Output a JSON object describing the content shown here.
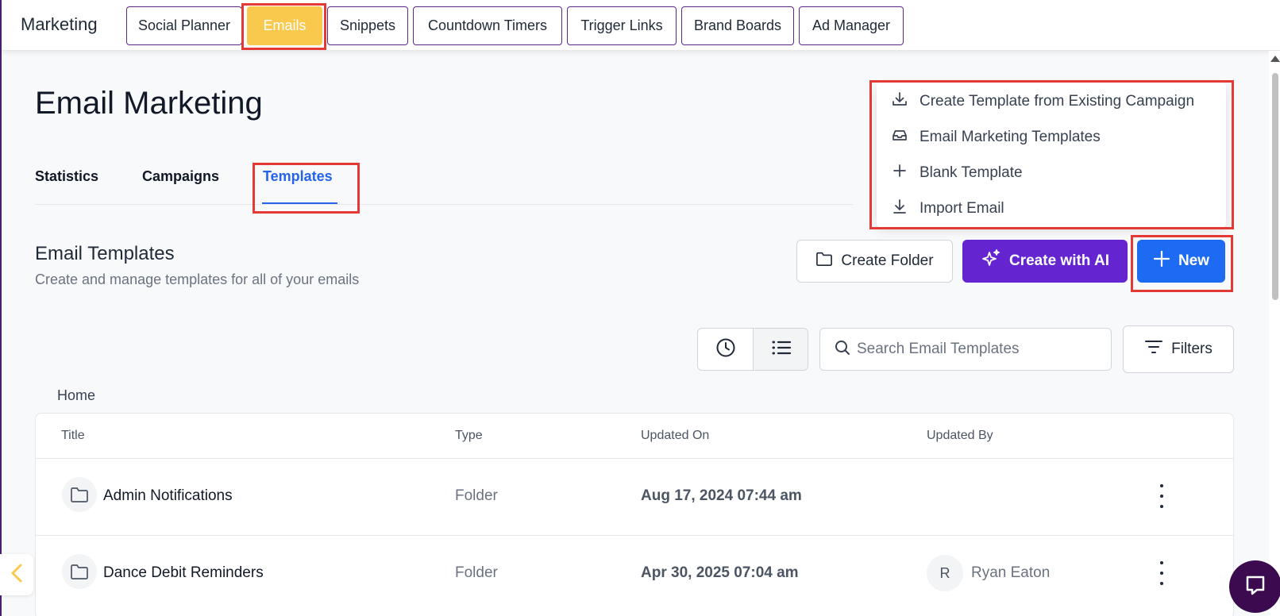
{
  "topbar": {
    "brand": "Marketing",
    "tabs": [
      {
        "label": "Social Planner"
      },
      {
        "label": "Emails"
      },
      {
        "label": "Snippets"
      },
      {
        "label": "Countdown Timers"
      },
      {
        "label": "Trigger Links"
      },
      {
        "label": "Brand Boards"
      },
      {
        "label": "Ad Manager"
      }
    ]
  },
  "page": {
    "title": "Email Marketing",
    "tabs": [
      {
        "label": "Statistics"
      },
      {
        "label": "Campaigns"
      },
      {
        "label": "Templates"
      }
    ]
  },
  "section": {
    "title": "Email Templates",
    "subtitle": "Create and manage templates for all of your emails"
  },
  "actions": {
    "create_folder": "Create Folder",
    "create_ai": "Create with AI",
    "new": "New"
  },
  "menu": {
    "items": [
      {
        "label": "Create Template from Existing Campaign",
        "icon": "download-tray-icon"
      },
      {
        "label": "Email Marketing Templates",
        "icon": "inbox-icon"
      },
      {
        "label": "Blank Template",
        "icon": "plus-icon"
      },
      {
        "label": "Import Email",
        "icon": "import-icon"
      }
    ]
  },
  "search": {
    "placeholder": "Search Email Templates"
  },
  "filters_label": "Filters",
  "breadcrumb": "Home",
  "table": {
    "headers": {
      "title": "Title",
      "type": "Type",
      "updated_on": "Updated On",
      "updated_by": "Updated By"
    },
    "rows": [
      {
        "title": "Admin Notifications",
        "type": "Folder",
        "updated_on": "Aug 17, 2024 07:44 am",
        "updated_by": "",
        "avatar": ""
      },
      {
        "title": "Dance Debit Reminders",
        "type": "Folder",
        "updated_on": "Apr 30, 2025 07:04 am",
        "updated_by": "Ryan Eaton",
        "avatar": "R"
      }
    ]
  },
  "colors": {
    "active_tab": "#f9c94e",
    "nav_border": "#5b2a86",
    "ai_button": "#6425d0",
    "new_button": "#1d6bf3",
    "link_blue": "#2563eb",
    "highlight": "#e53935"
  }
}
